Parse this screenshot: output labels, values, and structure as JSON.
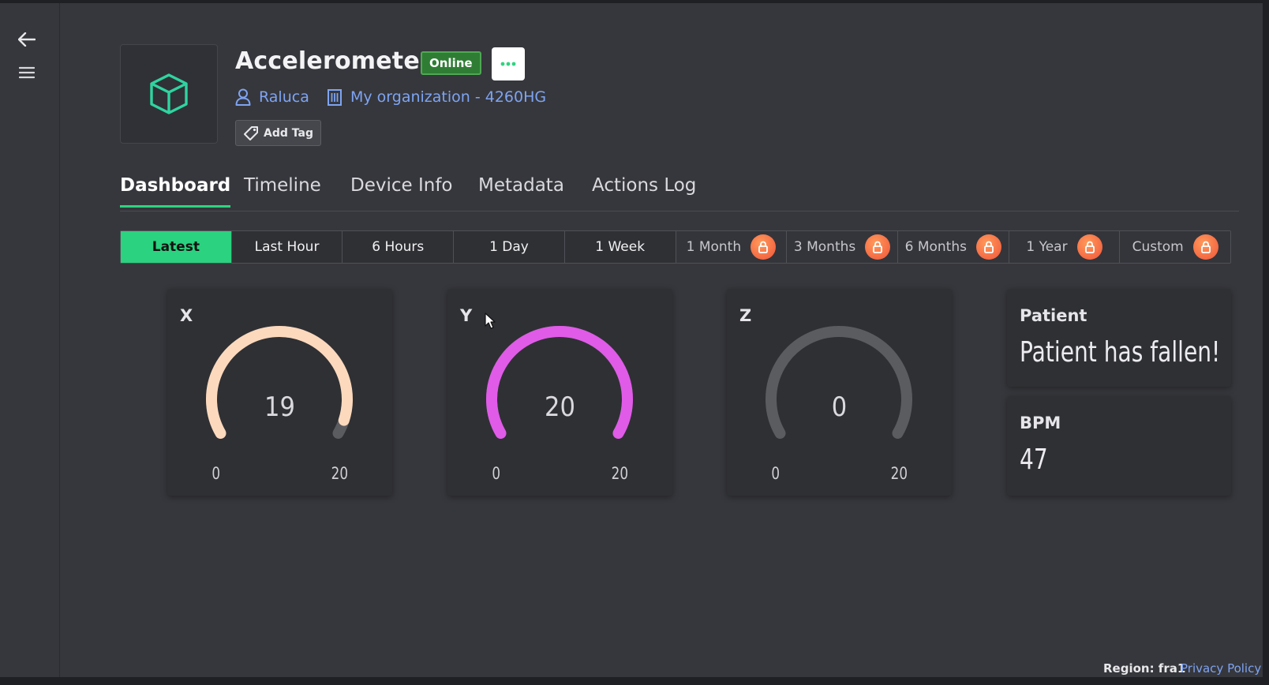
{
  "device": {
    "title": "Accelerometer",
    "status": "Online",
    "owner": "Raluca",
    "organization": "My organization - 4260HG",
    "add_tag_label": "Add Tag"
  },
  "tabs": [
    {
      "label": "Dashboard",
      "active": true
    },
    {
      "label": "Timeline"
    },
    {
      "label": "Device Info"
    },
    {
      "label": "Metadata"
    },
    {
      "label": "Actions Log"
    }
  ],
  "ranges": [
    {
      "label": "Latest",
      "active": true,
      "locked": false
    },
    {
      "label": "Last Hour",
      "locked": false
    },
    {
      "label": "6 Hours",
      "locked": false
    },
    {
      "label": "1 Day",
      "locked": false
    },
    {
      "label": "1 Week",
      "locked": false
    },
    {
      "label": "1 Month",
      "locked": true
    },
    {
      "label": "3 Months",
      "locked": true
    },
    {
      "label": "6 Months",
      "locked": true
    },
    {
      "label": "1 Year",
      "locked": true
    },
    {
      "label": "Custom",
      "locked": true
    }
  ],
  "widgets": {
    "x": {
      "label": "X",
      "value": 19,
      "min": "0",
      "max": "20",
      "color": "#fcd9bd"
    },
    "y": {
      "label": "Y",
      "value": 20,
      "min": "0",
      "max": "20",
      "color": "#e05be8"
    },
    "z": {
      "label": "Z",
      "value": 0,
      "min": "0",
      "max": "20",
      "color": "#5b5c60"
    },
    "patient": {
      "label": "Patient",
      "text": "Patient has fallen!"
    },
    "bpm": {
      "label": "BPM",
      "value": "47"
    }
  },
  "footer": {
    "region": "Region: fra1",
    "privacy": "Privacy Policy"
  },
  "colors": {
    "accent": "#2bd27f",
    "link": "#7ea4f2",
    "badge": "#2f7d35",
    "lock": "#f0543a",
    "gauge_track": "#5b5c60"
  }
}
